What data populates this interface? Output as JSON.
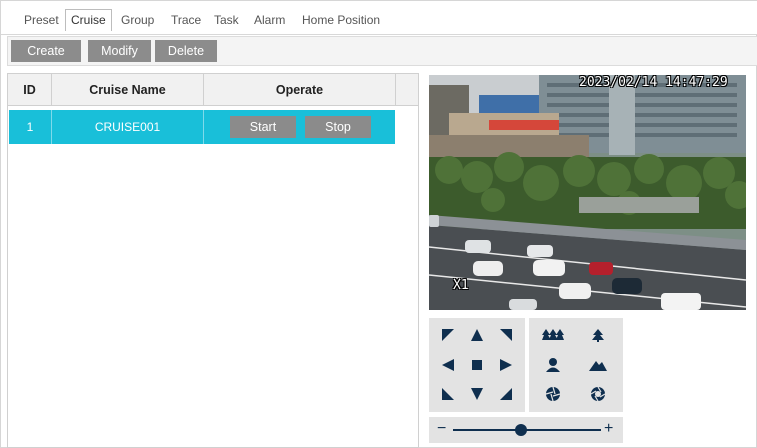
{
  "tabs": [
    {
      "label": "Preset",
      "active": false
    },
    {
      "label": "Cruise",
      "active": true
    },
    {
      "label": "Group",
      "active": false
    },
    {
      "label": "Trace",
      "active": false
    },
    {
      "label": "Task",
      "active": false
    },
    {
      "label": "Alarm",
      "active": false
    },
    {
      "label": "Home Position",
      "active": false
    }
  ],
  "toolbar": {
    "create_label": "Create",
    "modify_label": "Modify",
    "delete_label": "Delete"
  },
  "table": {
    "columns": [
      "ID",
      "Cruise Name",
      "Operate"
    ],
    "rows": [
      {
        "id": "1",
        "name": "CRUISE001",
        "start_label": "Start",
        "stop_label": "Stop",
        "selected": true
      }
    ]
  },
  "video": {
    "timestamp": "2023/02/14 14:47:29",
    "zoom_label": "X1"
  },
  "ptz": {
    "directional_icons": [
      "up-left-arrow-icon",
      "up-arrow-icon",
      "up-right-arrow-icon",
      "left-arrow-icon",
      "stop-square-icon",
      "right-arrow-icon",
      "down-left-arrow-icon",
      "down-arrow-icon",
      "down-right-arrow-icon"
    ],
    "function_icons": [
      "zoom-out-trees-icon",
      "zoom-in-tree-icon",
      "focus-near-person-icon",
      "focus-far-mountain-icon",
      "iris-close-icon",
      "iris-open-icon"
    ],
    "zoom_slider": {
      "minus": "−",
      "plus": "+",
      "level": 0.46
    }
  },
  "colors": {
    "selected_row": "#19bfd9",
    "button_gray": "#8b8b8b",
    "ptz_icon": "#0f2f4f",
    "ptz_bg": "#e3e3e3"
  }
}
